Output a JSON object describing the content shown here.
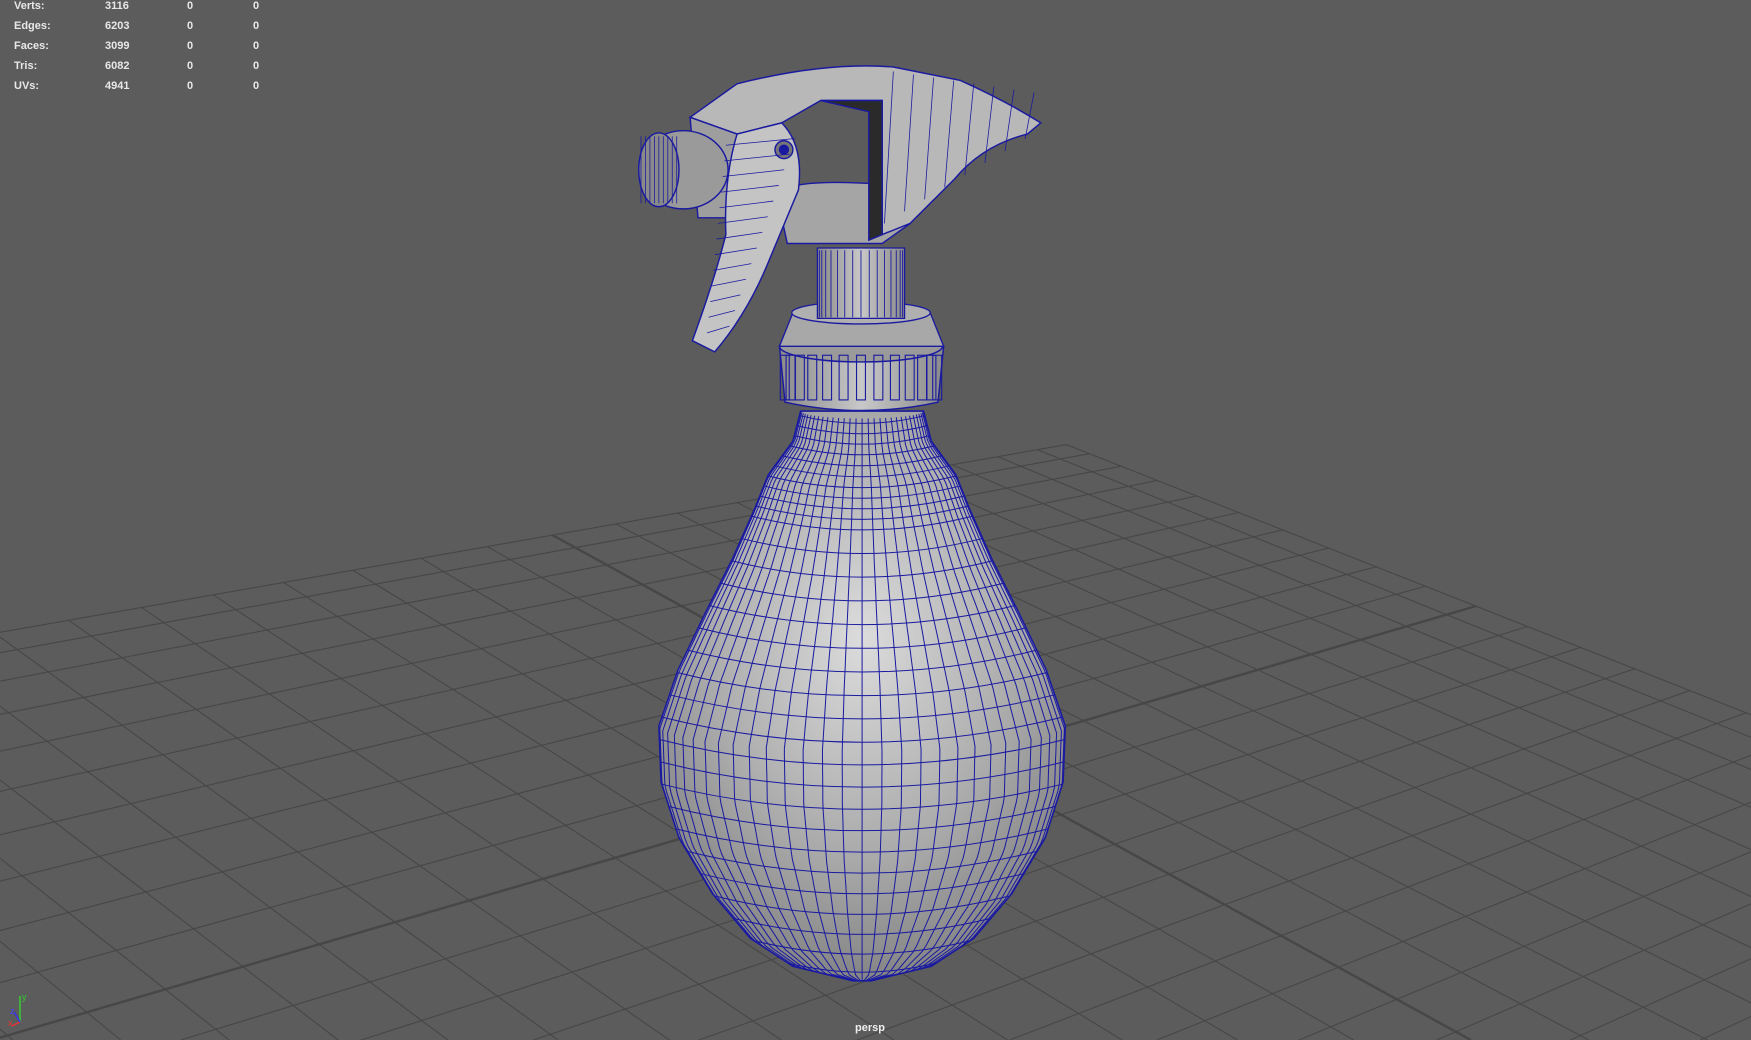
{
  "hud": {
    "rows": [
      {
        "label": "Verts:",
        "v1": "3116",
        "v2": "0",
        "v3": "0"
      },
      {
        "label": "Edges:",
        "v1": "6203",
        "v2": "0",
        "v3": "0"
      },
      {
        "label": "Faces:",
        "v1": "3099",
        "v2": "0",
        "v3": "0"
      },
      {
        "label": "Tris:",
        "v1": "6082",
        "v2": "0",
        "v3": "0"
      },
      {
        "label": "UVs:",
        "v1": "4941",
        "v2": "0",
        "v3": "0"
      }
    ]
  },
  "camera": {
    "name": "persp"
  },
  "axis": {
    "x": "x",
    "y": "y",
    "z": "z"
  },
  "colors": {
    "background": "#5c5c5c",
    "grid": "#444444",
    "wire": "#1a1aa0",
    "surface": "#b4b4b4"
  }
}
